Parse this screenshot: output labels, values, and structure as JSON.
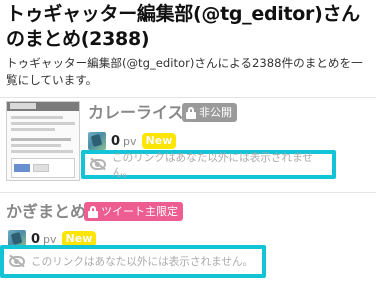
{
  "header": {
    "title": "トゥギャッター編集部(@tg_editor)さんのまとめ(2388)",
    "description": "トゥギャッター編集部(@tg_editor)さんによる2388件のまとめを一覧にしています。"
  },
  "items": [
    {
      "title": "カレーライス",
      "badge": "非公開",
      "badge_color": "#9a9a9a",
      "pv_count": "0",
      "pv_unit": "pv",
      "new_label": "New",
      "private_notice": "このリンクはあなた以外には表示されません。"
    },
    {
      "title": "かぎまとめ",
      "badge": "ツイート主限定",
      "badge_color": "#ee5d8f",
      "pv_count": "0",
      "pv_unit": "pv",
      "new_label": "New",
      "private_notice": "このリンクはあなた以外には表示されません。"
    }
  ],
  "colors": {
    "highlight_border": "#12c4d6",
    "new_badge": "#ffe600"
  }
}
